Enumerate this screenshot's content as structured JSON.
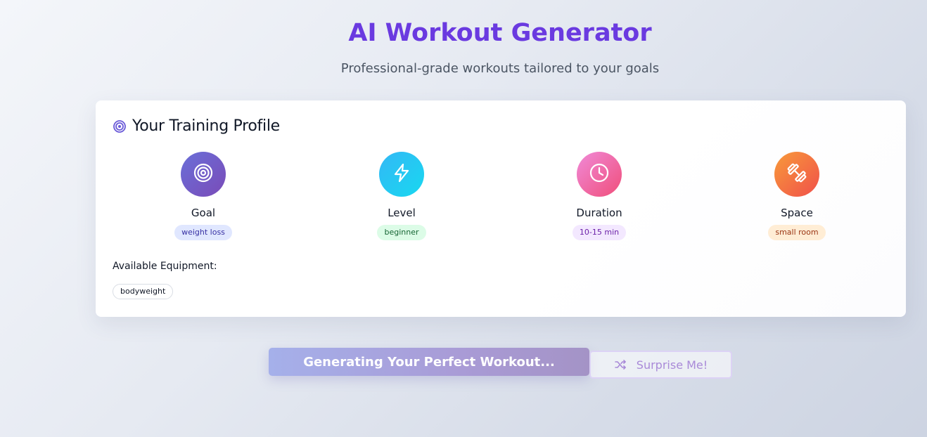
{
  "header": {
    "title": "AI Workout Generator",
    "subtitle": "Professional-grade workouts tailored to your goals"
  },
  "profile": {
    "title": "Your Training Profile",
    "title_icon": "target-icon",
    "stats": [
      {
        "label": "Goal",
        "value": "weight loss",
        "icon": "target-icon",
        "color": "#6a6fd8"
      },
      {
        "label": "Level",
        "value": "beginner",
        "icon": "lightning-icon",
        "color": "#33b8f5"
      },
      {
        "label": "Duration",
        "value": "10-15 min",
        "icon": "clock-icon",
        "color": "#f04e7a"
      },
      {
        "label": "Space",
        "value": "small room",
        "icon": "dumbbell-icon",
        "color": "#f0504a"
      }
    ],
    "equipment_label": "Available Equipment:",
    "equipment": [
      "bodyweight"
    ]
  },
  "actions": {
    "generate_label": "Generating Your Perfect Workout...",
    "surprise_label": "Surprise Me!",
    "surprise_icon": "shuffle-icon"
  },
  "colors": {
    "accent": "#6a3ae0",
    "button_gradient_start": "#a5b0ea",
    "button_gradient_end": "#a493c6"
  }
}
